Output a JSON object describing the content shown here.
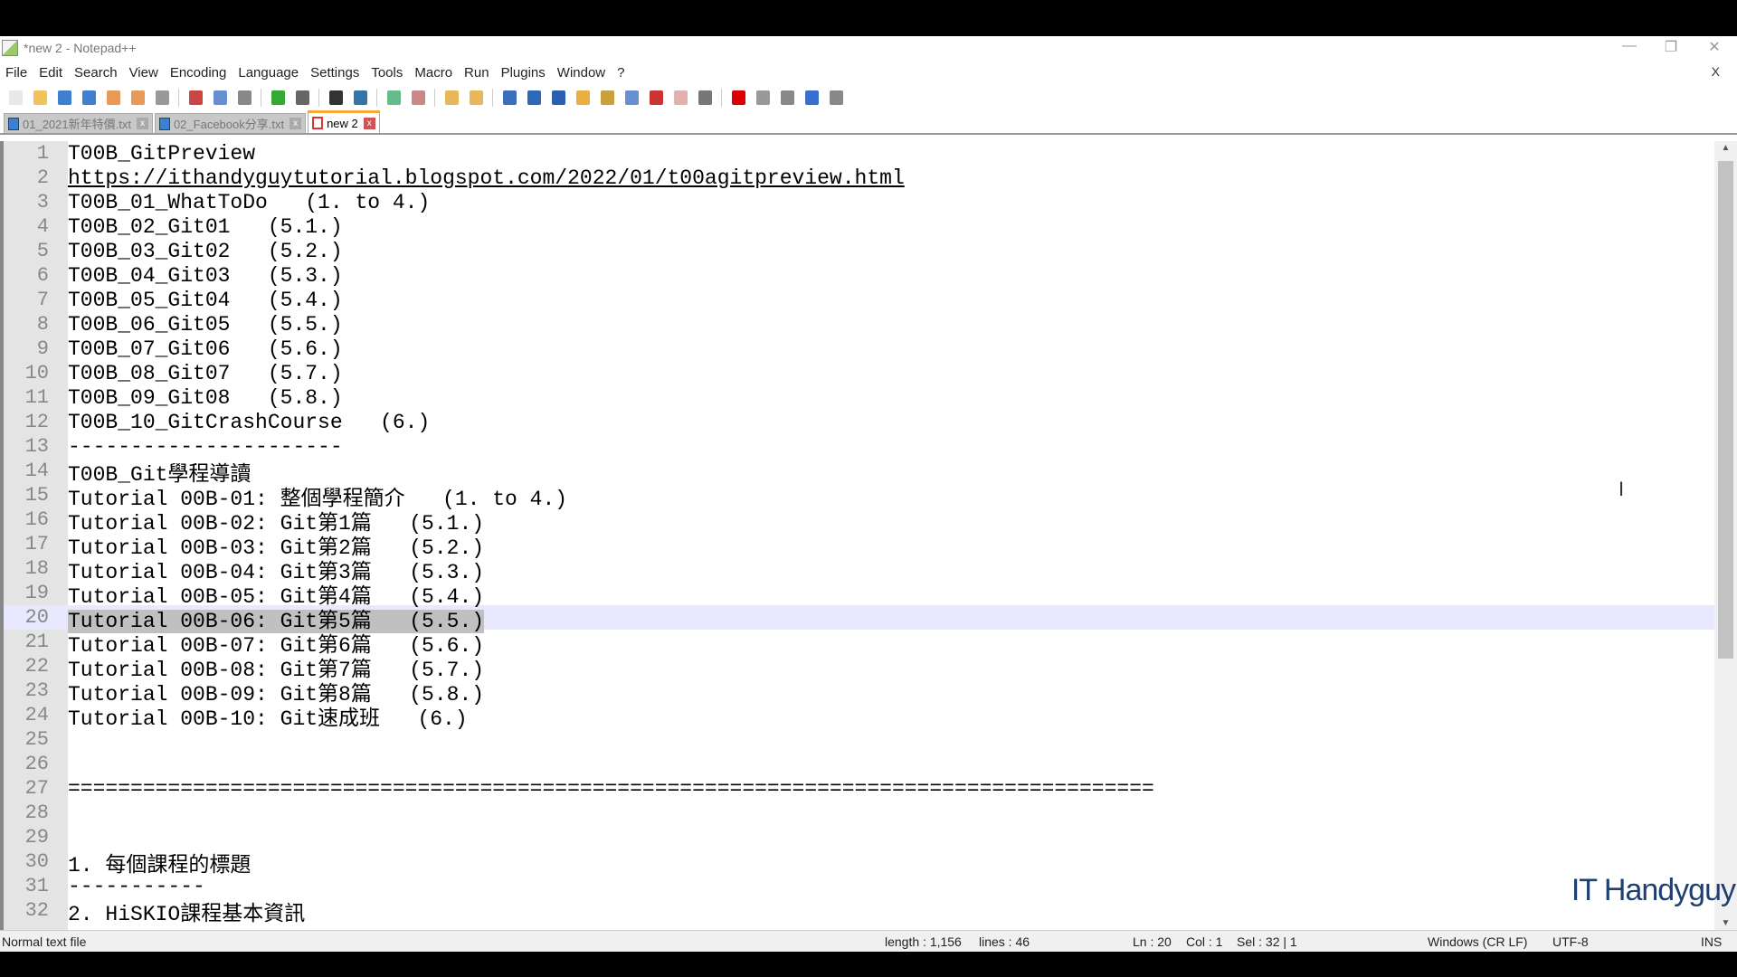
{
  "window": {
    "title": "*new 2 - Notepad++",
    "minimize": "—",
    "restore": "❐",
    "close": "✕"
  },
  "menu": [
    "File",
    "Edit",
    "Search",
    "View",
    "Encoding",
    "Language",
    "Settings",
    "Tools",
    "Macro",
    "Run",
    "Plugins",
    "Window",
    "?"
  ],
  "menu_close": "X",
  "toolbar": [
    {
      "icon": "new-file-icon",
      "color": "#e8e8e8"
    },
    {
      "icon": "open-file-icon",
      "color": "#f1c35a"
    },
    {
      "icon": "save-icon",
      "color": "#3f7fcf"
    },
    {
      "icon": "save-all-icon",
      "color": "#3f7fcf"
    },
    {
      "icon": "close-file-icon",
      "color": "#e89a5a"
    },
    {
      "icon": "close-all-icon",
      "color": "#e89a5a"
    },
    {
      "icon": "print-icon",
      "color": "#999"
    },
    {
      "sep": true
    },
    {
      "icon": "cut-icon",
      "color": "#c44"
    },
    {
      "icon": "copy-icon",
      "color": "#6a8fd0"
    },
    {
      "icon": "paste-icon",
      "color": "#888"
    },
    {
      "sep": true
    },
    {
      "icon": "undo-icon",
      "color": "#3a3"
    },
    {
      "icon": "redo-icon",
      "color": "#666"
    },
    {
      "sep": true
    },
    {
      "icon": "find-icon",
      "color": "#333"
    },
    {
      "icon": "replace-icon",
      "color": "#37a"
    },
    {
      "sep": true
    },
    {
      "icon": "zoom-in-icon",
      "color": "#6b8"
    },
    {
      "icon": "zoom-out-icon",
      "color": "#c88"
    },
    {
      "sep": true
    },
    {
      "icon": "sync-vertical-icon",
      "color": "#e7b75b"
    },
    {
      "icon": "sync-horizontal-icon",
      "color": "#e7b75b"
    },
    {
      "sep": true
    },
    {
      "icon": "word-wrap-icon",
      "color": "#3a6fc0"
    },
    {
      "icon": "show-all-chars-icon",
      "color": "#2b6ab8"
    },
    {
      "icon": "indent-guide-icon",
      "color": "#2b5fb0"
    },
    {
      "icon": "udl-icon",
      "color": "#e8b040"
    },
    {
      "icon": "doc-map-icon",
      "color": "#c9a040"
    },
    {
      "icon": "function-list-icon",
      "color": "#6a8fd0"
    },
    {
      "icon": "folder-workspace-icon",
      "color": "#c33"
    },
    {
      "icon": "doc-list-icon",
      "color": "#e3b0b0"
    },
    {
      "icon": "monitoring-icon",
      "color": "#777"
    },
    {
      "sep": true
    },
    {
      "icon": "record-macro-icon",
      "color": "#d00"
    },
    {
      "icon": "stop-record-icon",
      "color": "#999"
    },
    {
      "icon": "play-macro-icon",
      "color": "#888"
    },
    {
      "icon": "run-macro-multiple-icon",
      "color": "#3a6fd0"
    },
    {
      "icon": "save-macro-icon",
      "color": "#888"
    }
  ],
  "tabs": [
    {
      "label": "01_2021新年特價.txt",
      "active": false
    },
    {
      "label": "02_Facebook分享.txt",
      "active": false
    },
    {
      "label": "new 2",
      "active": true
    }
  ],
  "tab_close": "x",
  "editor": {
    "current_line": 20,
    "selected_text": "Tutorial 00B-06: Git第5篇   (5.5.)",
    "lines": [
      "T00B_GitPreview",
      "https://ithandyguytutorial.blogspot.com/2022/01/t00agitpreview.html",
      "T00B_01_WhatToDo   (1. to 4.)",
      "T00B_02_Git01   (5.1.)",
      "T00B_03_Git02   (5.2.)",
      "T00B_04_Git03   (5.3.)",
      "T00B_05_Git04   (5.4.)",
      "T00B_06_Git05   (5.5.)",
      "T00B_07_Git06   (5.6.)",
      "T00B_08_Git07   (5.7.)",
      "T00B_09_Git08   (5.8.)",
      "T00B_10_GitCrashCourse   (6.)",
      "----------------------",
      "T00B_Git學程導讀",
      "Tutorial 00B-01: 整個學程簡介   (1. to 4.)",
      "Tutorial 00B-02: Git第1篇   (5.1.)",
      "Tutorial 00B-03: Git第2篇   (5.2.)",
      "Tutorial 00B-04: Git第3篇   (5.3.)",
      "Tutorial 00B-05: Git第4篇   (5.4.)",
      "Tutorial 00B-06: Git第5篇   (5.5.)",
      "Tutorial 00B-07: Git第6篇   (5.6.)",
      "Tutorial 00B-08: Git第7篇   (5.7.)",
      "Tutorial 00B-09: Git第8篇   (5.8.)",
      "Tutorial 00B-10: Git速成班   (6.)",
      "",
      "",
      "=======================================================================================",
      "",
      "",
      "1. 每個課程的標題",
      "-----------",
      "2. HiSKIO課程基本資訊"
    ],
    "scroll_up": "▲",
    "scroll_down": "▼",
    "ibeam": "I"
  },
  "status": {
    "file_type": "Normal text file",
    "length": "length : 1,156",
    "lines": "lines : 46",
    "ln": "Ln : 20",
    "col": "Col : 1",
    "sel": "Sel : 32 | 1",
    "eol": "Windows (CR LF)",
    "encoding": "UTF-8",
    "mode": "INS"
  },
  "watermark": "IT Handyguy"
}
